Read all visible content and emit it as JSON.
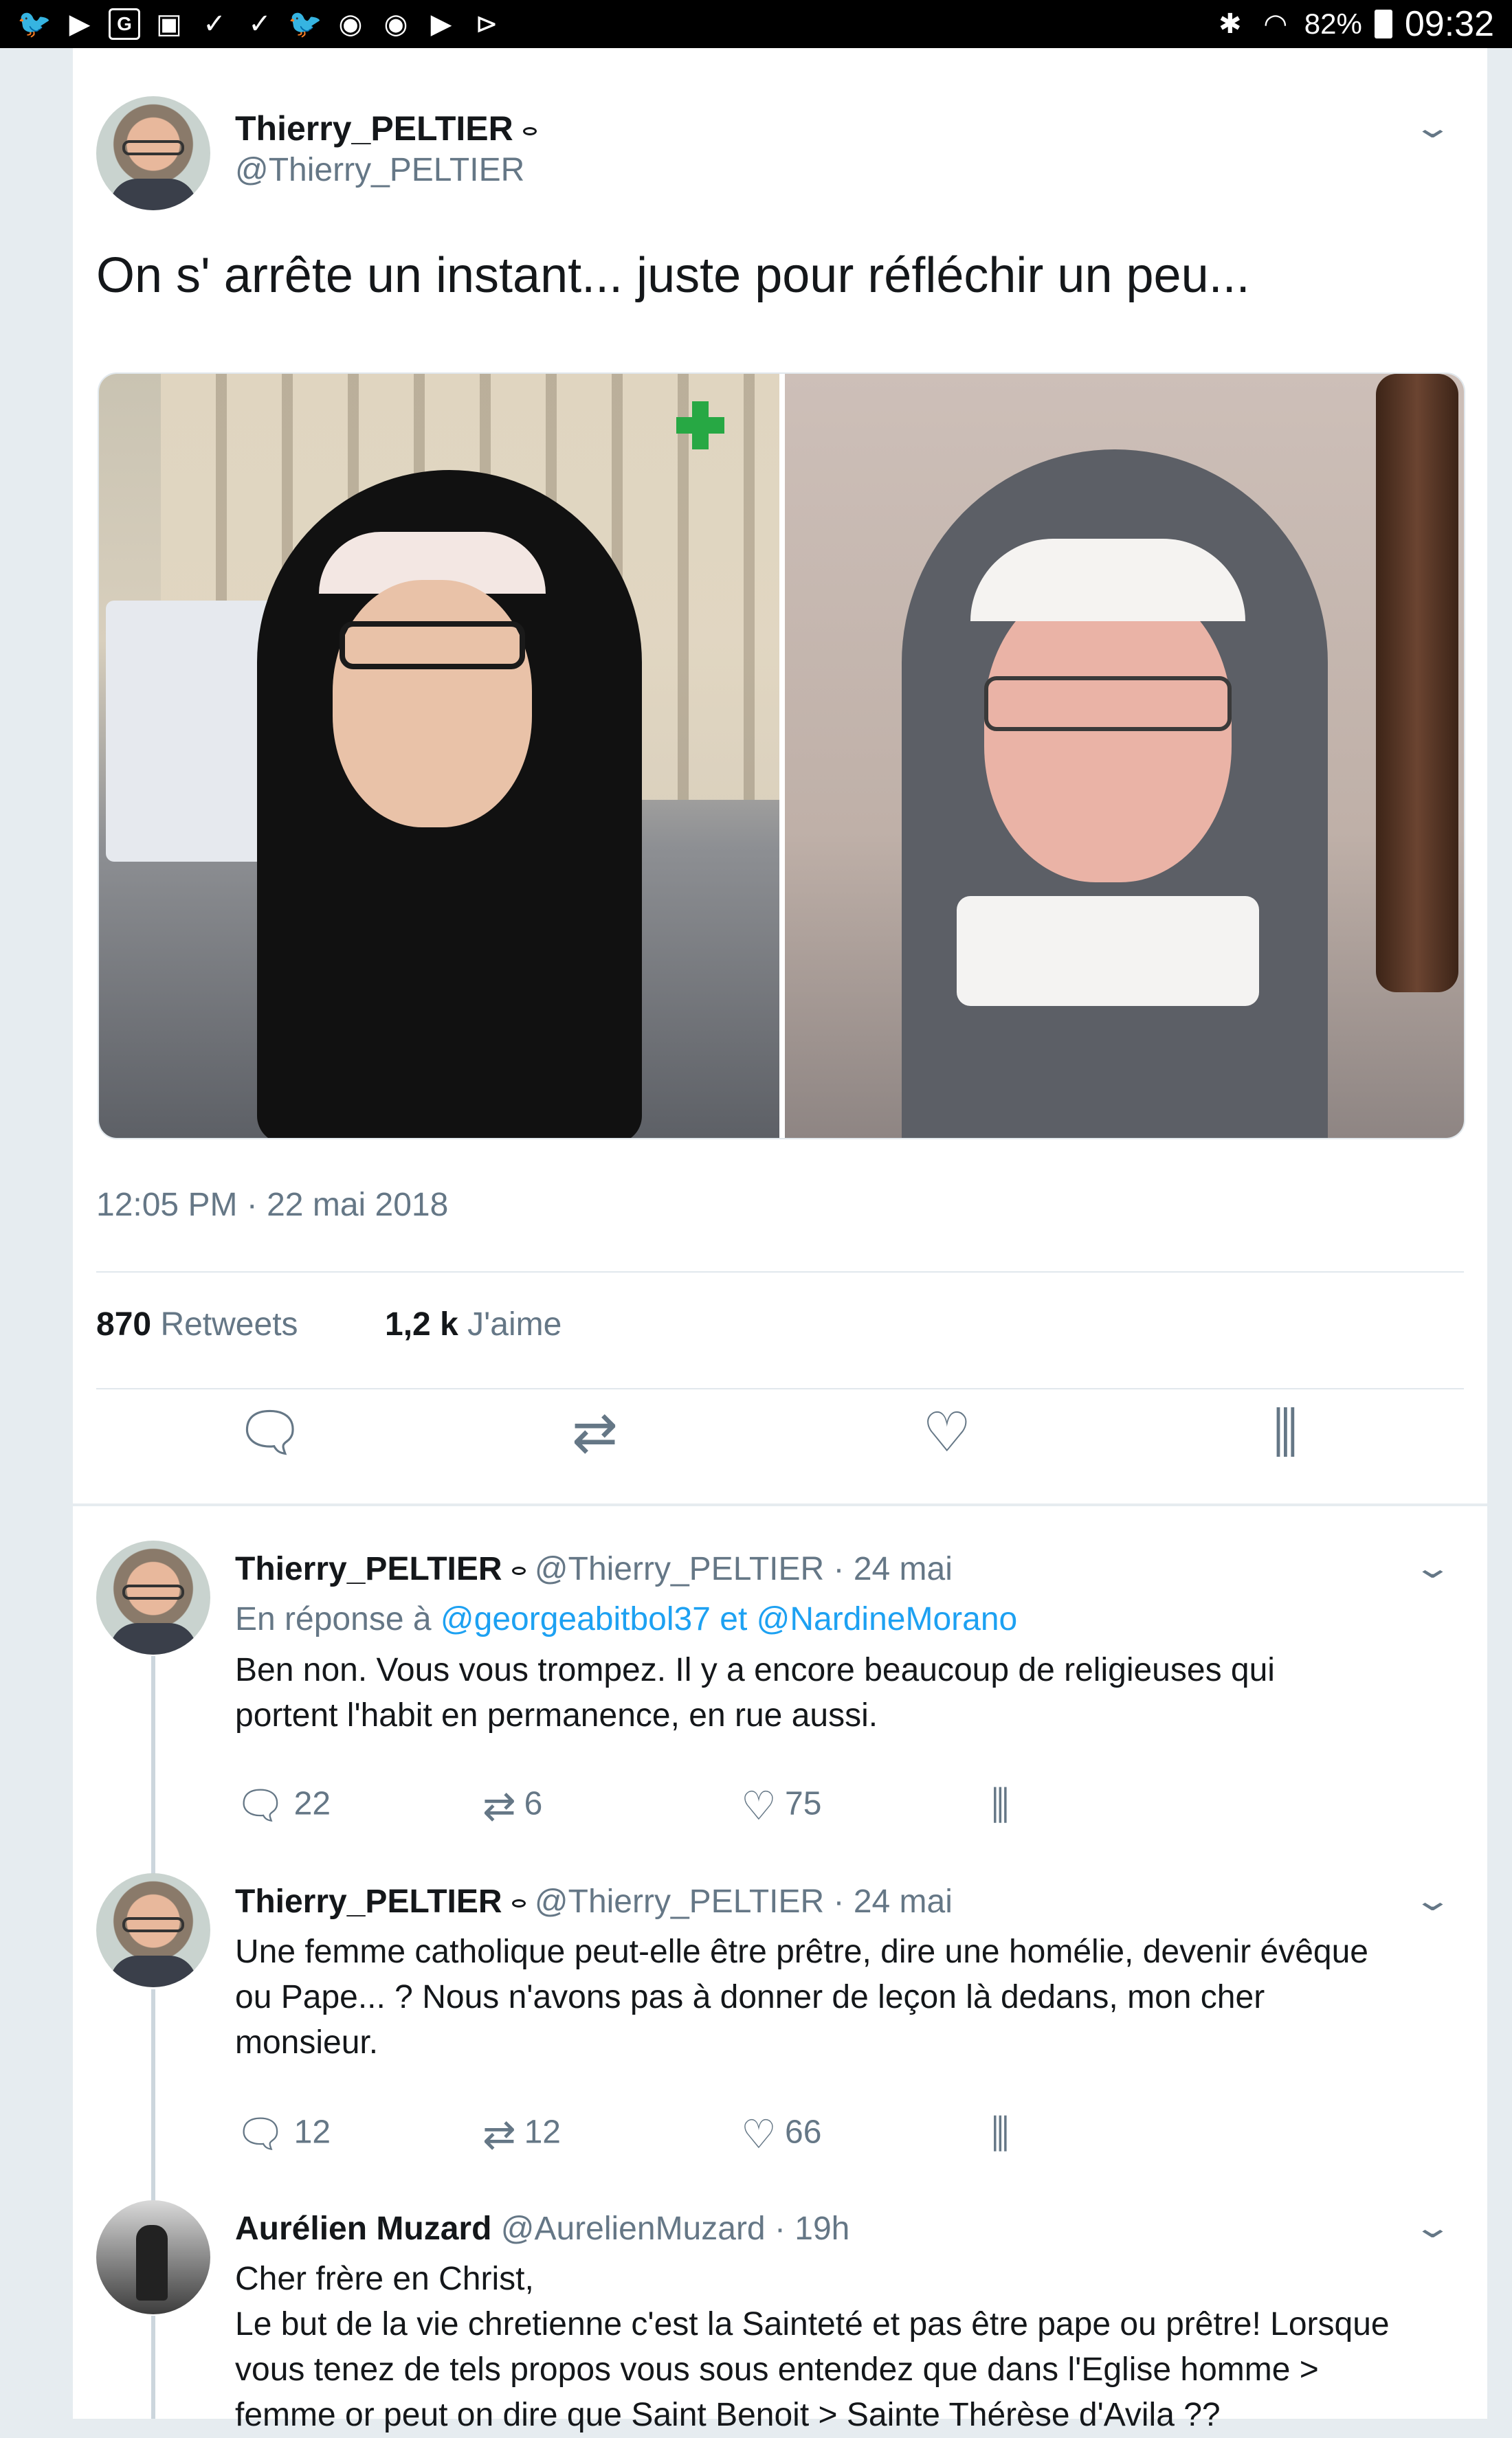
{
  "status_bar": {
    "left_icons": [
      "twitter-icon",
      "youtube-icon",
      "google-icon",
      "screenshot-icon",
      "check-icon",
      "check-icon",
      "twitter-icon",
      "chrome-icon",
      "chrome-icon",
      "youtube-icon",
      "play-store-icon"
    ],
    "battery": "82%",
    "time": "09:32"
  },
  "main_tweet": {
    "name": "Thierry_PELTIER",
    "handle": "@Thierry_PELTIER",
    "text": "On s' arrête un instant... juste pour réfléchir un peu...",
    "timestamp": "12:05 PM · 22 mai 2018",
    "retweets_count": "870",
    "retweets_label": "Retweets",
    "likes_count": "1,2 k",
    "likes_label": "J'aime"
  },
  "replies": [
    {
      "name": "Thierry_PELTIER",
      "handle": "@Thierry_PELTIER · 24 mai",
      "reply_to_prefix": "En réponse à",
      "reply_to_1": "@georgeabitbol37",
      "reply_to_and": "et",
      "reply_to_2": "@NardineMorano",
      "lines": [
        "Ben non. Vous vous trompez. Il y a encore beaucoup de religieuses qui",
        "portent l'habit en permanence, en rue aussi."
      ],
      "replies": "22",
      "retweets": "6",
      "likes": "75"
    },
    {
      "name": "Thierry_PELTIER",
      "handle": "@Thierry_PELTIER · 24 mai",
      "lines": [
        "Une femme catholique peut-elle être prêtre, dire une homélie, devenir évêque",
        "ou Pape... ? Nous n'avons pas à donner de leçon là dedans, mon cher",
        "monsieur."
      ],
      "replies": "12",
      "retweets": "12",
      "likes": "66"
    },
    {
      "name": "Aurélien Muzard",
      "handle": "@AurelienMuzard · 19h",
      "lines": [
        "Cher frère en Christ,",
        "Le but de la vie chretienne c'est la Sainteté et pas être pape ou prêtre! Lorsque",
        "vous tenez de tels propos vous sous entendez que dans l'Eglise homme >",
        "femme or peut on dire que Saint Benoit > Sainte Thérèse d'Avila ??"
      ]
    }
  ],
  "colors": {
    "accent": "#1da1f2",
    "secondary_text": "#657786",
    "background": "#e6ecf0"
  }
}
